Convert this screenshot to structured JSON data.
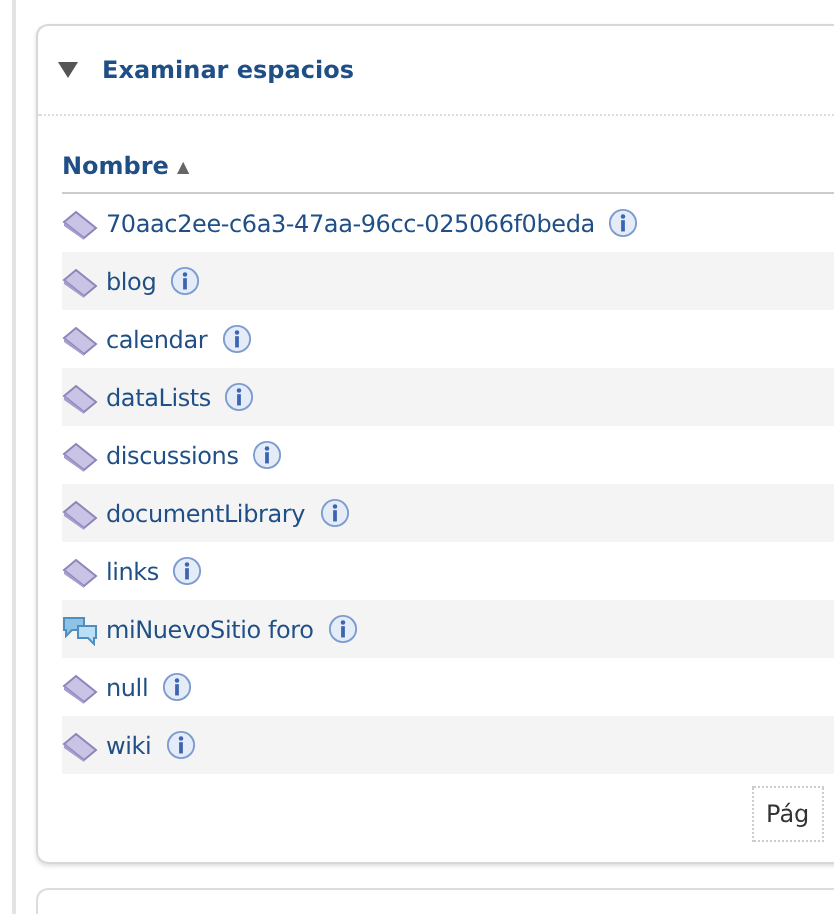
{
  "panel": {
    "title": "Examinar espacios",
    "expanded": true
  },
  "table": {
    "column": "Nombre",
    "sort_indicator": "▲",
    "rows": [
      {
        "name": "70aac2ee-c6a3-47aa-96cc-025066f0beda",
        "kind": "space"
      },
      {
        "name": "blog",
        "kind": "space"
      },
      {
        "name": "calendar",
        "kind": "space"
      },
      {
        "name": "dataLists",
        "kind": "space"
      },
      {
        "name": "discussions",
        "kind": "space"
      },
      {
        "name": "documentLibrary",
        "kind": "space"
      },
      {
        "name": "links",
        "kind": "space"
      },
      {
        "name": "miNuevoSitio foro",
        "kind": "forum"
      },
      {
        "name": "null",
        "kind": "space"
      },
      {
        "name": "wiki",
        "kind": "space"
      }
    ]
  },
  "pagination": {
    "label": "Pág"
  }
}
